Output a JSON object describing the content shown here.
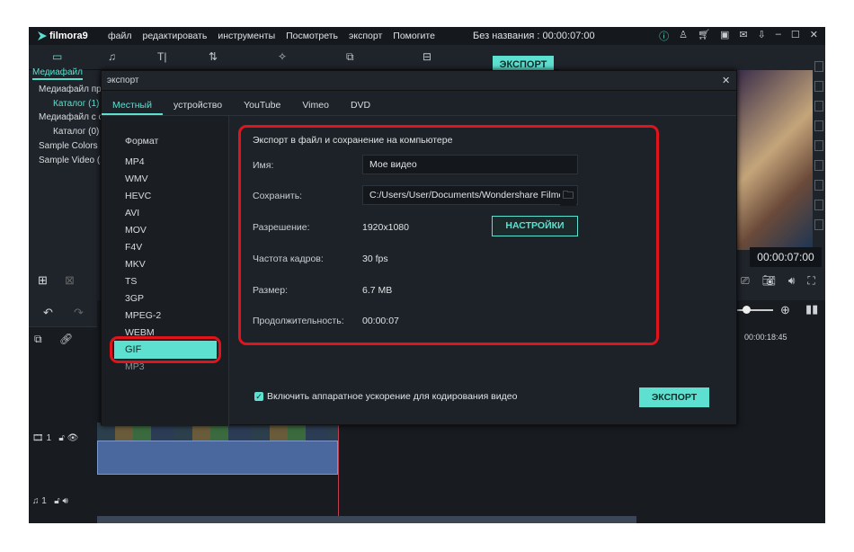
{
  "app": {
    "logo": "filmora9",
    "menu": [
      "файл",
      "редактировать",
      "инструменты",
      "Посмотреть",
      "экспорт",
      "Помогите"
    ],
    "title": "Без названия : 00:00:07:00",
    "export_button": "ЭКСПОРТ"
  },
  "sidebar": {
    "tab": "Медиафайл",
    "items": [
      "Медиафайл пр",
      "Каталог (1)",
      "Медиафайл с с",
      "Каталог (0)",
      "Sample Colors (",
      "Sample Video (2"
    ]
  },
  "dialog": {
    "title": "экспорт",
    "tabs": [
      "Местный",
      "устройство",
      "YouTube",
      "Vimeo",
      "DVD"
    ],
    "formats_label": "Формат",
    "formats": [
      "MP4",
      "WMV",
      "HEVC",
      "AVI",
      "MOV",
      "F4V",
      "MKV",
      "TS",
      "3GP",
      "MPEG-2",
      "WEBM",
      "GIF",
      "MP3"
    ],
    "selected_format": "GIF",
    "section_title": "Экспорт в файл и сохранение на компьютере",
    "name_label": "Имя:",
    "name_value": "Мое видео",
    "save_label": "Сохранить:",
    "save_value": "C:/Users/User/Documents/Wondershare Filmora",
    "resolution_label": "Разрешение:",
    "resolution_value": "1920x1080",
    "settings_button": "НАСТРОЙКИ",
    "fps_label": "Частота кадров:",
    "fps_value": "30 fps",
    "size_label": "Размер:",
    "size_value": "6.7 MB",
    "duration_label": "Продолжительность:",
    "duration_value": "00:00:07",
    "hw_accel_label": "Включить аппаратное ускорение для кодирования видео",
    "hw_accel_checked": true,
    "export_button": "ЭКСПОРТ"
  },
  "preview": {
    "timecode": "00:00:07:00"
  },
  "timeline": {
    "ruler_time": "00:00:18:45",
    "video_track": "1",
    "audio_track": "1"
  },
  "colors": {
    "accent": "#5de0cf",
    "highlight": "#e0141c"
  }
}
